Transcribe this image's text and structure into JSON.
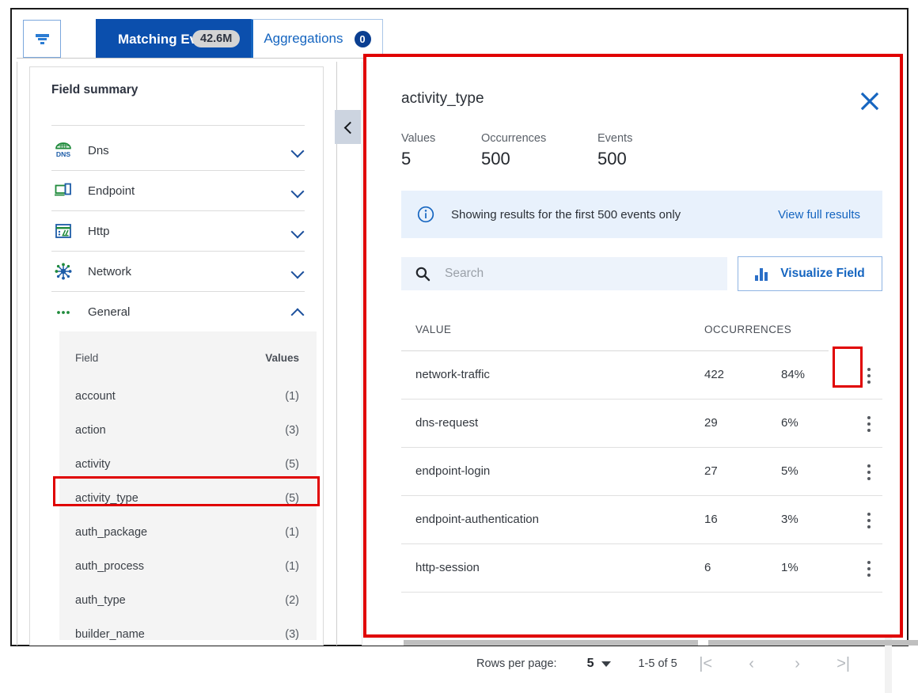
{
  "toolbar": {
    "filter_icon": "filter-funnel-icon",
    "tabs": [
      {
        "label": "Matching Events",
        "badge": "42.6M",
        "active": true
      },
      {
        "label": "Aggregations",
        "badge": "0",
        "active": false
      }
    ]
  },
  "sidebar": {
    "title": "Field summary",
    "collapse_icon": "chevron-left-icon",
    "categories": [
      {
        "label": "Dns",
        "icon": "dns-globe-icon",
        "expanded": false
      },
      {
        "label": "Endpoint",
        "icon": "endpoint-device-icon",
        "expanded": false
      },
      {
        "label": "Http",
        "icon": "http-browser-icon",
        "expanded": false
      },
      {
        "label": "Network",
        "icon": "network-nodes-icon",
        "expanded": false
      },
      {
        "label": "General",
        "icon": "ellipsis-icon",
        "expanded": true
      }
    ],
    "field_table": {
      "columns": [
        "Field",
        "Values"
      ],
      "rows": [
        {
          "field": "account",
          "values": "(1)",
          "highlighted": false
        },
        {
          "field": "action",
          "values": "(3)",
          "highlighted": false
        },
        {
          "field": "activity",
          "values": "(5)",
          "highlighted": false
        },
        {
          "field": "activity_type",
          "values": "(5)",
          "highlighted": true
        },
        {
          "field": "auth_package",
          "values": "(1)",
          "highlighted": false
        },
        {
          "field": "auth_process",
          "values": "(1)",
          "highlighted": false
        },
        {
          "field": "auth_type",
          "values": "(2)",
          "highlighted": false
        },
        {
          "field": "builder_name",
          "values": "(3)",
          "highlighted": false
        }
      ]
    }
  },
  "dialog": {
    "title": "activity_type",
    "close_icon": "close-x-icon",
    "stats": [
      {
        "label": "Values",
        "value": "5"
      },
      {
        "label": "Occurrences",
        "value": "500"
      },
      {
        "label": "Events",
        "value": "500"
      }
    ],
    "info_banner": {
      "icon": "info-circle-icon",
      "text": "Showing results for the first 500 events only",
      "action_label": "View full results"
    },
    "search": {
      "icon": "search-icon",
      "placeholder": "Search",
      "value": ""
    },
    "visualize_button": {
      "label": "Visualize Field",
      "icon": "bar-chart-icon"
    },
    "table": {
      "columns": [
        "VALUE",
        "OCCURRENCES"
      ],
      "rows": [
        {
          "value": "network-traffic",
          "occurrences": "422",
          "percent": "84%",
          "menu_icon": "kebab-menu-icon",
          "menu_highlighted": true
        },
        {
          "value": "dns-request",
          "occurrences": "29",
          "percent": "6%",
          "menu_icon": "kebab-menu-icon",
          "menu_highlighted": false
        },
        {
          "value": "endpoint-login",
          "occurrences": "27",
          "percent": "5%",
          "menu_icon": "kebab-menu-icon",
          "menu_highlighted": false
        },
        {
          "value": "endpoint-authentication",
          "occurrences": "16",
          "percent": "3%",
          "menu_icon": "kebab-menu-icon",
          "menu_highlighted": false
        },
        {
          "value": "http-session",
          "occurrences": "6",
          "percent": "1%",
          "menu_icon": "kebab-menu-icon",
          "menu_highlighted": false
        }
      ]
    },
    "pagination": {
      "rows_per_page_label": "Rows per page:",
      "rows_per_page_value": "5",
      "range_text": "1-5 of 5",
      "first_icon": "|<",
      "prev_icon": "‹",
      "next_icon": "›",
      "last_icon": ">|"
    }
  },
  "colors": {
    "accent_blue": "#1565c0",
    "tab_active_bg": "#0b4fad",
    "annotation_red": "#e00000",
    "info_bg": "#e8f1fc",
    "search_bg": "#edf3fb",
    "field_table_bg": "#f4f4f4"
  }
}
